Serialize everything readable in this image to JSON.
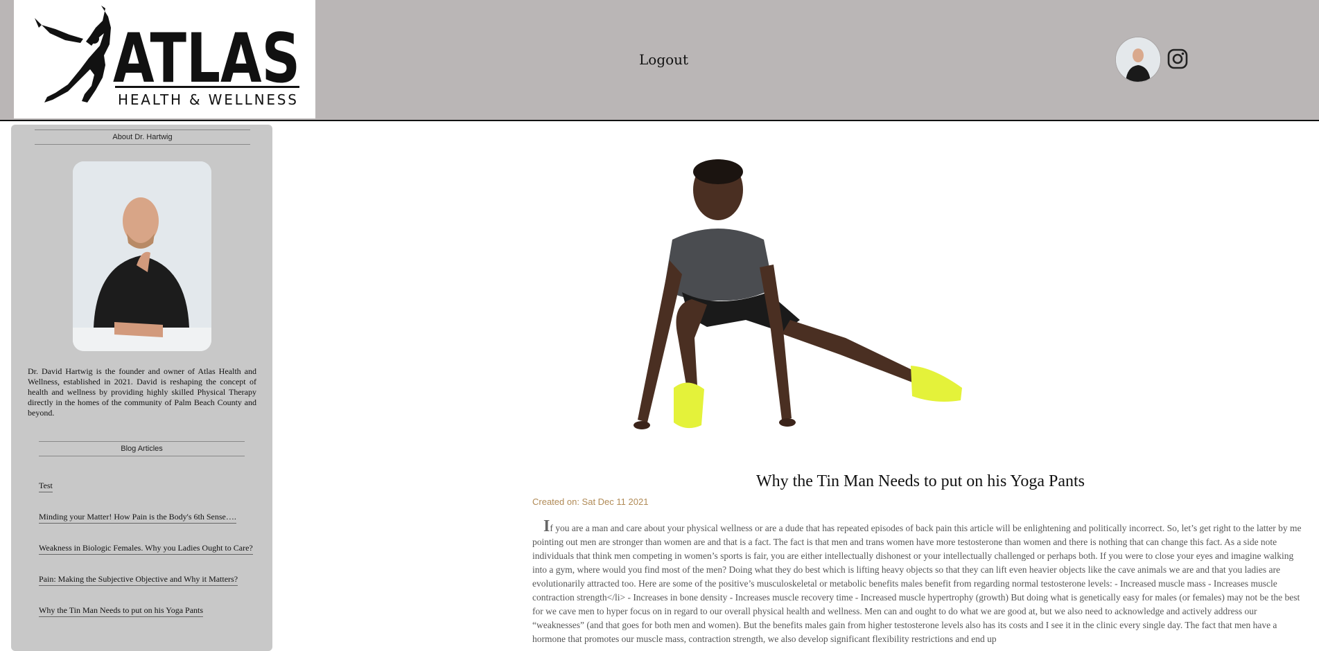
{
  "header": {
    "logo": {
      "wordmark": "ATLAS",
      "tagline": "HEALTH & WELLNESS"
    },
    "logout_label": "Logout"
  },
  "sidebar": {
    "about_heading": "About Dr. Hartwig",
    "bio": "Dr. David Hartwig is the founder and owner of Atlas Health and Wellness, established in 2021. David is reshaping the concept of health and wellness by providing highly skilled Physical Therapy directly in the homes of the community of Palm Beach County and beyond.",
    "blog_heading": "Blog Articles",
    "articles": [
      "Test",
      "Minding your Matter! How Pain is the Body's 6th Sense….",
      "Weakness in Biologic Females. Why you Ladies Ought to Care?",
      "Pain: Making the Subjective Objective and Why it Matters?",
      "Why the Tin Man Needs to put on his Yoga Pants"
    ]
  },
  "article": {
    "title": "Why the Tin Man Needs to put on his Yoga Pants",
    "created": "Created on: Sat Dec 11 2021",
    "dropcap": "I",
    "body": "f you are a man and care about your physical wellness or are a dude that has repeated episodes of back pain this article will be enlightening and politically incorrect. So, let’s get right to the latter by me pointing out men are stronger than women are and that is a fact. The fact is that men and trans women have more testosterone than women and there is nothing that can change this fact. As a side note individuals that think men competing in women’s sports is fair, you are either intellectually dishonest or your intellectually challenged or perhaps both. If you were to close your eyes and imagine walking into a gym, where would you find most of the men? Doing what they do best which is lifting heavy objects so that they can lift even heavier objects like the cave animals we are and that you ladies are evolutionarily attracted too. Here are some of the positive’s musculoskeletal or metabolic benefits males benefit from regarding normal testosterone levels: - Increased muscle mass - Increases muscle contraction strength</li> - Increases in bone density - Increases muscle recovery time - Increased muscle hypertrophy (growth) But doing what is genetically easy for males (or females) may not be the best for we cave men to hyper focus on in regard to our overall physical health and wellness. Men can and ought to do what we are good at, but we also need to acknowledge and actively address our “weaknesses” (and that goes for both men and women). But the benefits males gain from higher testosterone levels also has its costs and I see it in the clinic every single day. The fact that men have a hormone that promotes our muscle mass, contraction strength, we also develop significant flexibility restrictions and end up"
  },
  "colors": {
    "header_bg": "#bab6b6",
    "sidebar_bg": "#c8c8c8",
    "date_color": "#b08a56",
    "shoe_color": "#e4f23a"
  },
  "icons": {
    "social": "instagram-icon"
  }
}
